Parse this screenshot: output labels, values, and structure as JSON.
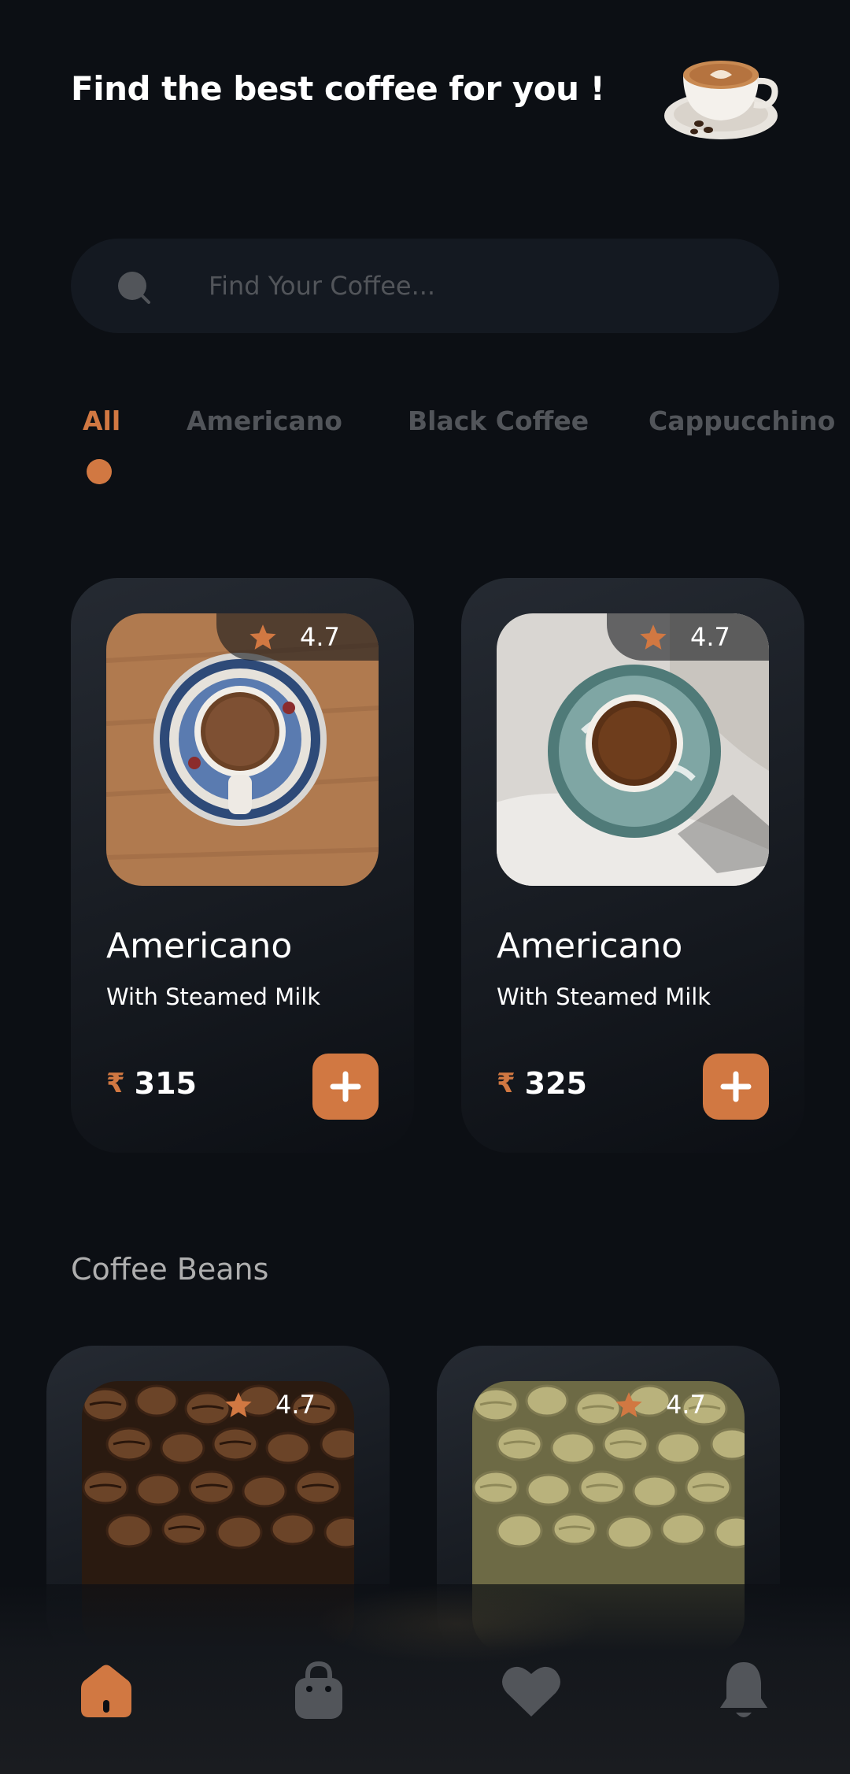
{
  "header": {
    "title": "Find the best coffee for you !"
  },
  "search": {
    "placeholder": "Find Your Coffee..."
  },
  "tabs": [
    {
      "label": "All",
      "active": true
    },
    {
      "label": "Americano",
      "active": false
    },
    {
      "label": "Black Coffee",
      "active": false
    },
    {
      "label": "Cappucchino",
      "active": false
    }
  ],
  "coffee_cards": [
    {
      "name": "Americano",
      "subtitle": "With Steamed Milk",
      "rating": "4.7",
      "currency": "₹",
      "price": "315"
    },
    {
      "name": "Americano",
      "subtitle": "With Steamed Milk",
      "rating": "4.7",
      "currency": "₹",
      "price": "325"
    }
  ],
  "beans_section": {
    "title": "Coffee Beans"
  },
  "bean_cards": [
    {
      "rating": "4.7"
    },
    {
      "rating": "4.7"
    }
  ],
  "nav": [
    {
      "icon": "home-icon",
      "active": true
    },
    {
      "icon": "bag-icon",
      "active": false
    },
    {
      "icon": "heart-icon",
      "active": false
    },
    {
      "icon": "bell-icon",
      "active": false
    }
  ],
  "colors": {
    "accent": "#d17842",
    "background": "#0c0f14",
    "inactive": "#52555a"
  }
}
